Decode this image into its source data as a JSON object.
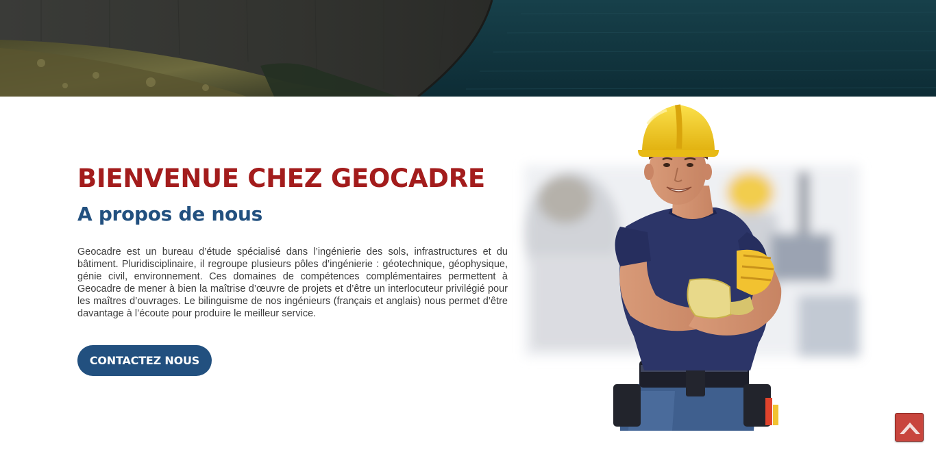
{
  "hero": {
    "image_subject": "dam-reservoir-landscape"
  },
  "intro": {
    "welcome_title": "BIENVENUE CHEZ GEOCADRE",
    "section_title": "A propos de nous",
    "description": "Geocadre est un bureau d’étude spécialisé dans l’ingénierie des sols, infrastructures et du bâtiment. Pluridisciplinaire, il regroupe plusieurs pôles d’ingénierie : géotechnique, géophysique, génie civil, environnement. Ces domaines de compétences complémentaires permettent à Geocadre de mener à bien la maîtrise d’œuvre de projets et d’être un interlocuteur privilégié pour les maîtres d’ouvrages. Le bilinguisme de nos ingénieurs (français et anglais) nous permet d’être davantage à l’écoute pour produire le meilleur service.",
    "cta_label": "CONTACTEZ NOUS"
  },
  "illustration": {
    "subject": "construction-worker-with-hard-hat"
  },
  "scroll_top": {
    "icon": "arrow-up-icon"
  },
  "colors": {
    "title_red": "#a31c1c",
    "brand_blue": "#22507f",
    "body_text": "#3c3c3c",
    "scroll_button": "#c8453d",
    "helmet_yellow": "#f2c81b",
    "shirt_navy": "#2c3568"
  }
}
